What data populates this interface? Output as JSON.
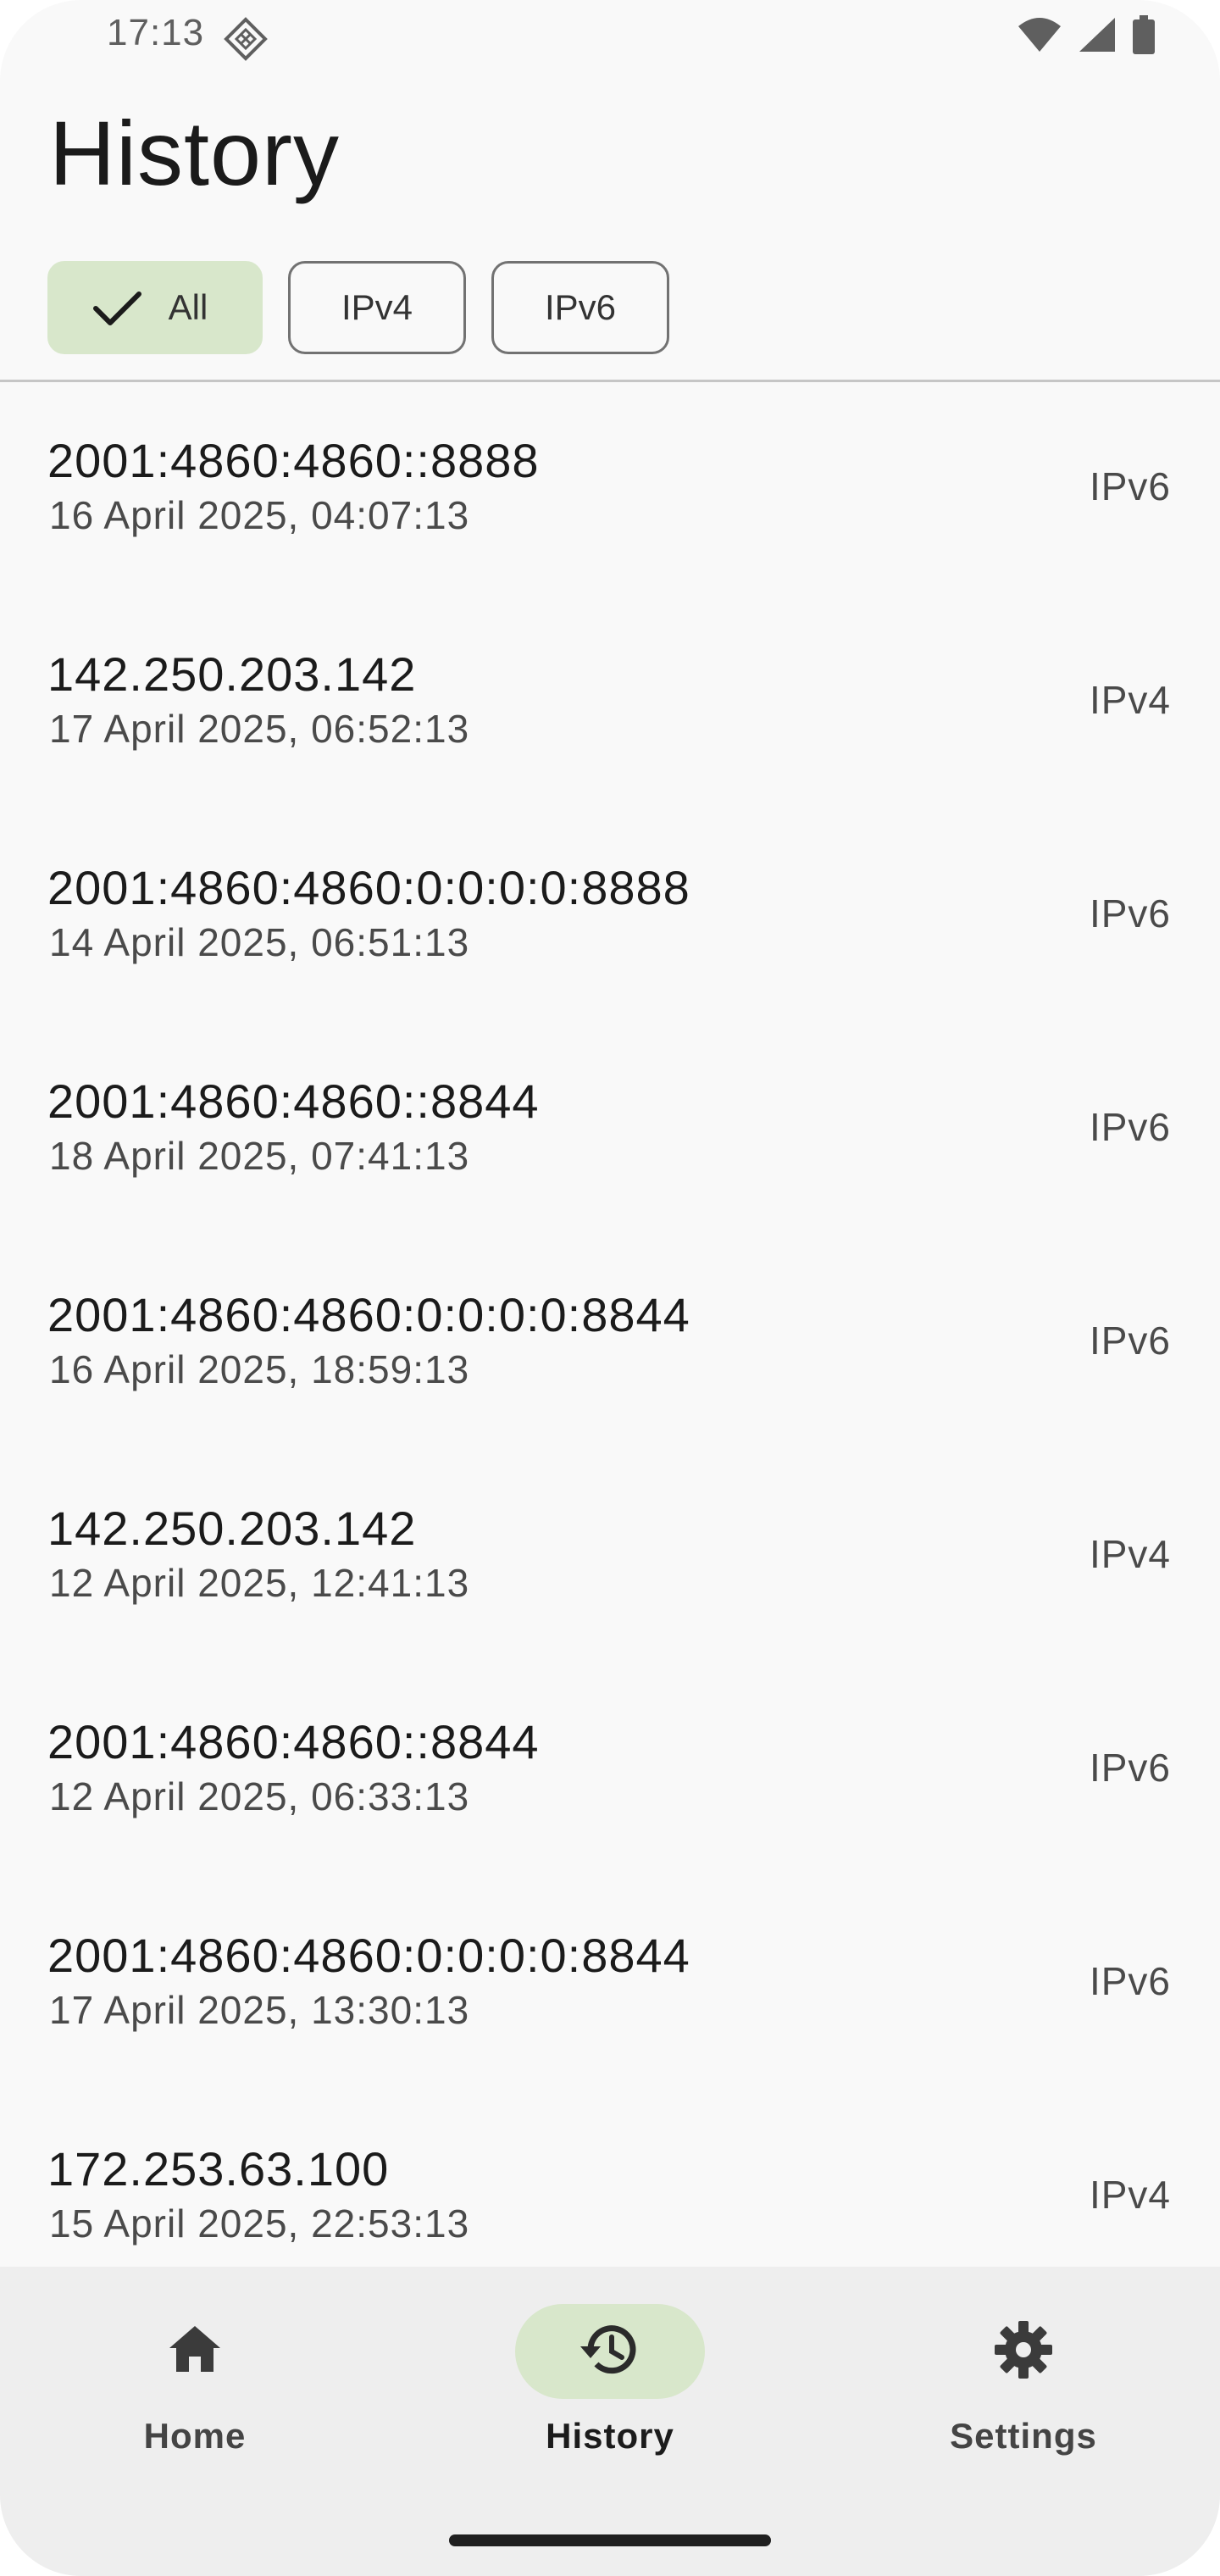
{
  "status_bar": {
    "time": "17:13",
    "app_icon": "diamond-grid-icon",
    "icons": [
      "wifi-icon",
      "signal-icon",
      "battery-icon"
    ]
  },
  "header": {
    "title": "History"
  },
  "filters": {
    "all_label": "All",
    "ipv4_label": "IPv4",
    "ipv6_label": "IPv6",
    "selected": "All"
  },
  "history": [
    {
      "address": "2001:4860:4860::8888",
      "date": "16 April 2025, 04:07:13",
      "type": "IPv6"
    },
    {
      "address": "142.250.203.142",
      "date": "17 April 2025, 06:52:13",
      "type": "IPv4"
    },
    {
      "address": "2001:4860:4860:0:0:0:0:8888",
      "date": "14 April 2025, 06:51:13",
      "type": "IPv6"
    },
    {
      "address": "2001:4860:4860::8844",
      "date": "18 April 2025, 07:41:13",
      "type": "IPv6"
    },
    {
      "address": "2001:4860:4860:0:0:0:0:8844",
      "date": "16 April 2025, 18:59:13",
      "type": "IPv6"
    },
    {
      "address": "142.250.203.142",
      "date": "12 April 2025, 12:41:13",
      "type": "IPv4"
    },
    {
      "address": "2001:4860:4860::8844",
      "date": "12 April 2025, 06:33:13",
      "type": "IPv6"
    },
    {
      "address": "2001:4860:4860:0:0:0:0:8844",
      "date": "17 April 2025, 13:30:13",
      "type": "IPv6"
    },
    {
      "address": "172.253.63.100",
      "date": "15 April 2025, 22:53:13",
      "type": "IPv4"
    }
  ],
  "nav": {
    "home_label": "Home",
    "history_label": "History",
    "settings_label": "Settings",
    "active": "History"
  },
  "colors": {
    "accent_container": "#d8e7cb",
    "background": "#f9f9f9",
    "nav_background": "#eeeeee"
  }
}
